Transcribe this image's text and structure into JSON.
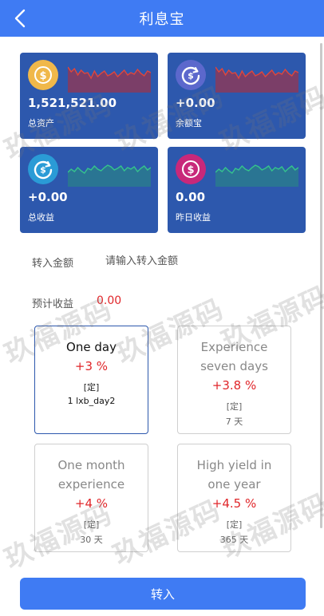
{
  "header": {
    "title": "利息宝"
  },
  "cards": [
    {
      "value": "1,521,521.00",
      "label": "总资产",
      "icon": "gold-coin-dollar-icon",
      "coin_color": "#f0b84a",
      "line_color": "#e0463b",
      "fill_color": "#8a3a5c"
    },
    {
      "value": "+0.00",
      "label": "余额宝",
      "icon": "purple-coin-refresh-icon",
      "coin_color": "#5c68cc",
      "line_color": "#e0463b",
      "fill_color": "#8a3a5c"
    },
    {
      "value": "+0.00",
      "label": "总收益",
      "icon": "blue-coin-refresh-icon",
      "coin_color": "#2a9bd6",
      "line_color": "#35c48c",
      "fill_color": "#2a7a8e"
    },
    {
      "value": "0.00",
      "label": "昨日收益",
      "icon": "pink-coin-dollar-icon",
      "coin_color": "#c8287a",
      "line_color": "#35c48c",
      "fill_color": "#2a7a8e"
    }
  ],
  "transfer": {
    "label": "转入金额",
    "placeholder": "请输入转入金额"
  },
  "expected": {
    "label": "预计收益",
    "value": "0.00"
  },
  "plans": [
    {
      "name": "One day",
      "rate": "+3 %",
      "tag": "[定]",
      "days": "1 lxb_day2",
      "selected": true
    },
    {
      "name": "Experience seven days",
      "rate": "+3.8 %",
      "tag": "[定]",
      "days": "7 天",
      "selected": false
    },
    {
      "name": "One month experience",
      "rate": "+4 %",
      "tag": "[定]",
      "days": "30 天",
      "selected": false
    },
    {
      "name": "High yield in one year",
      "rate": "+4.5 %",
      "tag": "[定]",
      "days": "365 天",
      "selected": false
    }
  ],
  "submit": {
    "label": "转入"
  },
  "watermark": {
    "text": "玖福源码"
  }
}
